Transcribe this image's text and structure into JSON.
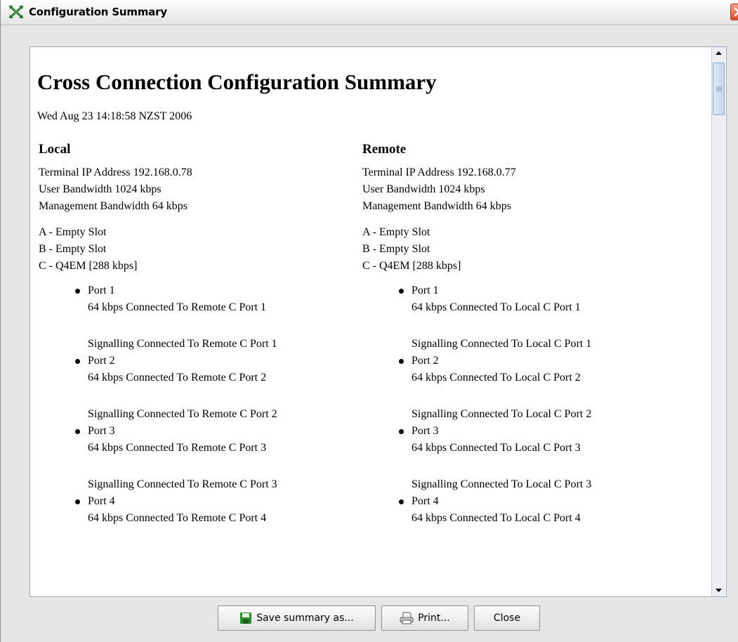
{
  "window": {
    "title": "Configuration Summary"
  },
  "document": {
    "title": "Cross Connection Configuration Summary",
    "date": "Wed Aug 23 14:18:58 NZST 2006",
    "local": {
      "heading": "Local",
      "terminal_ip": "Terminal IP Address 192.168.0.78",
      "user_bandwidth": "User Bandwidth 1024 kbps",
      "mgmt_bandwidth": "Management Bandwidth 64 kbps",
      "slots": [
        "A - Empty Slot",
        "B - Empty Slot",
        "C - Q4EM [288 kbps]"
      ],
      "ports": [
        {
          "name": "Port 1",
          "data": "64 kbps Connected To Remote C Port 1",
          "signalling": "Signalling Connected To Remote C Port 1"
        },
        {
          "name": "Port 2",
          "data": "64 kbps Connected To Remote C Port 2",
          "signalling": "Signalling Connected To Remote C Port 2"
        },
        {
          "name": "Port 3",
          "data": "64 kbps Connected To Remote C Port 3",
          "signalling": "Signalling Connected To Remote C Port 3"
        },
        {
          "name": "Port 4",
          "data": "64 kbps Connected To Remote C Port 4"
        }
      ]
    },
    "remote": {
      "heading": "Remote",
      "terminal_ip": "Terminal IP Address 192.168.0.77",
      "user_bandwidth": "User Bandwidth 1024 kbps",
      "mgmt_bandwidth": "Management Bandwidth 64 kbps",
      "slots": [
        "A - Empty Slot",
        "B - Empty Slot",
        "C - Q4EM [288 kbps]"
      ],
      "ports": [
        {
          "name": "Port 1",
          "data": "64 kbps Connected To Local C Port 1",
          "signalling": "Signalling Connected To Local C Port 1"
        },
        {
          "name": "Port 2",
          "data": "64 kbps Connected To Local C Port 2",
          "signalling": "Signalling Connected To Local C Port 2"
        },
        {
          "name": "Port 3",
          "data": "64 kbps Connected To Local C Port 3",
          "signalling": "Signalling Connected To Local C Port 3"
        },
        {
          "name": "Port 4",
          "data": "64 kbps Connected To Local C Port 4"
        }
      ]
    }
  },
  "buttons": {
    "save": "Save summary as...",
    "print": "Print...",
    "close": "Close"
  },
  "icons": {
    "app": "cross-arrows-icon",
    "close": "close-icon",
    "save": "floppy-disk-icon",
    "print": "printer-icon"
  },
  "colors": {
    "close_button": "#d9502f",
    "save_icon": "#2e8b2e"
  }
}
